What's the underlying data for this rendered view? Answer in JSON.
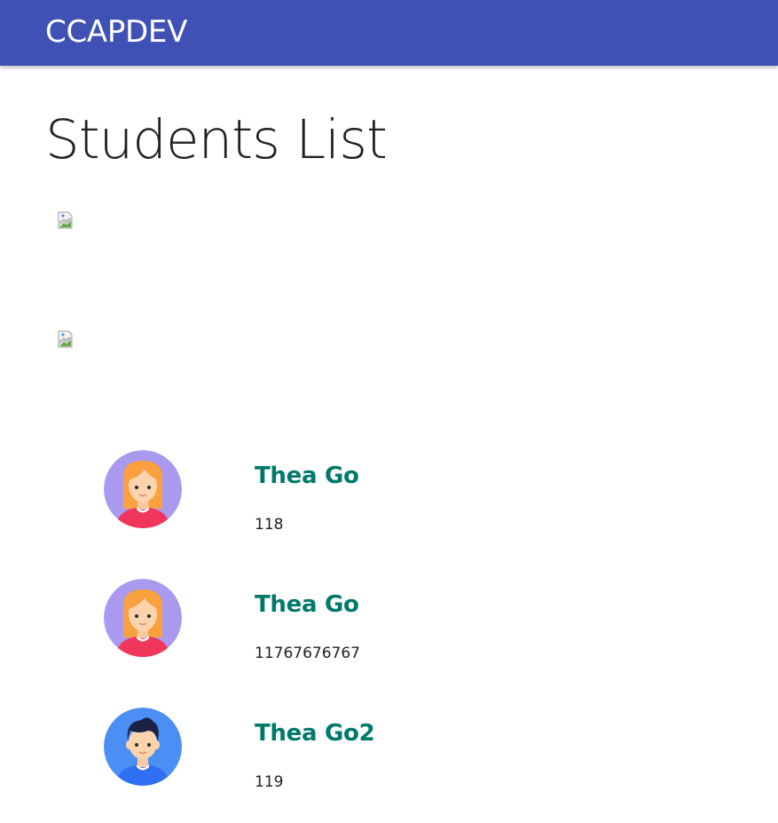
{
  "navbar": {
    "brand": "CCAPDEV",
    "color": "#3f51b5"
  },
  "page": {
    "title": "Students List"
  },
  "broken_images": [
    {
      "icon": "broken-image-icon"
    },
    {
      "icon": "broken-image-icon"
    }
  ],
  "students": [
    {
      "name": "Thea Go",
      "id_number": "118",
      "avatar": "female-avatar-icon",
      "avatar_bg": "#a99af0"
    },
    {
      "name": "Thea Go",
      "id_number": "11767676767",
      "avatar": "female-avatar-icon",
      "avatar_bg": "#a99af0"
    },
    {
      "name": "Thea Go2",
      "id_number": "119",
      "avatar": "male-avatar-icon",
      "avatar_bg": "#4b8ff5"
    }
  ],
  "colors": {
    "name_text": "#00796b",
    "title_text": "#212121"
  }
}
